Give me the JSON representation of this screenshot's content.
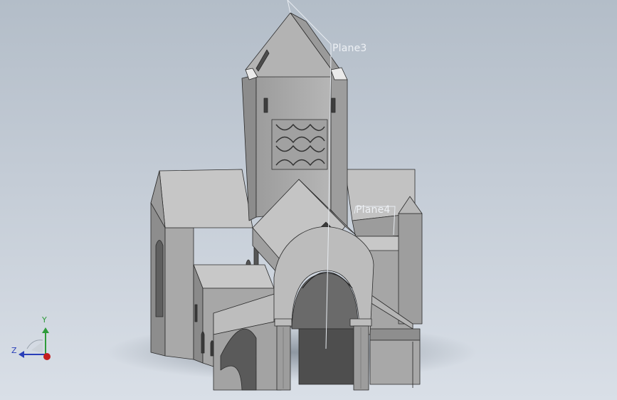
{
  "viewport": {
    "planes": [
      {
        "label": "Plane3"
      },
      {
        "label": "Plane4"
      }
    ],
    "triad": {
      "y_label": "Y",
      "z_label": "Z",
      "colors": {
        "x": "#c41e1e",
        "y": "#2e9b3a",
        "z": "#2a3fb8"
      }
    }
  },
  "colors": {
    "background_top": "#b3bdc8",
    "background_bottom": "#d9dfe7",
    "model_light": "#c8c8c8",
    "model_mid": "#a3a3a3",
    "model_dark": "#6e6e6e",
    "edge": "#2b2b2b",
    "plane_outline": "#e8ecf1"
  },
  "model": {
    "name_icon": "church-model"
  }
}
